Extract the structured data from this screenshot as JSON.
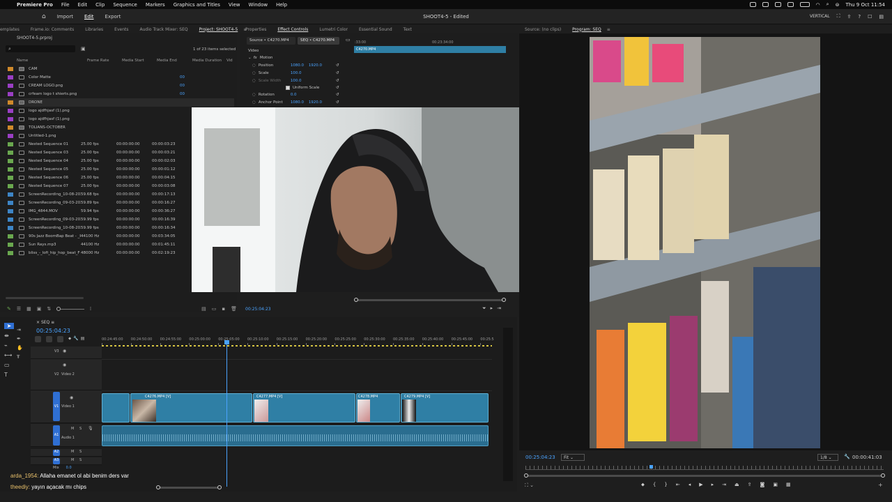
{
  "menubar": {
    "app_name": "Premiere Pro",
    "items": [
      "File",
      "Edit",
      "Clip",
      "Sequence",
      "Markers",
      "Graphics and Titles",
      "View",
      "Window",
      "Help"
    ],
    "datetime": "Thu 9 Oct  11:54"
  },
  "appheader": {
    "workspaces": [
      "Import",
      "Edit",
      "Export"
    ],
    "active_workspace": "Edit",
    "title": "SHOOT4-5 - Edited",
    "vertical_label": "VERTICAL"
  },
  "top_tabs": [
    "emplates",
    "Frame.io: Comments",
    "Libraries",
    "Events",
    "Audio Track Mixer: SEQ",
    "Project: SHOOT4-5"
  ],
  "active_top_tab": "Project: SHOOT4-5",
  "center_tabs": [
    "Properties",
    "Effect Controls",
    "Lumetri Color",
    "Essential Sound",
    "Text"
  ],
  "active_center_tab": "Effect Controls",
  "right_tabs": [
    "Source: (no clips)",
    "Program: SEQ"
  ],
  "active_right_tab": "Program: SEQ",
  "project": {
    "filename": "SHOOT4-5.prproj",
    "items_selected": "1 of 23 items selected",
    "columns": [
      "Name",
      "Frame Rate",
      "Media Start",
      "Media End",
      "Media Duration",
      "Vid"
    ],
    "rows": [
      {
        "name": "CAM",
        "fr": "",
        "ms": "",
        "me": "",
        "md": "",
        "color": "#d08a2b",
        "folder": true
      },
      {
        "name": "Color Matte",
        "fr": "",
        "ms": "",
        "me": "",
        "md": "00",
        "color": "#9a3fc4",
        "folder": false
      },
      {
        "name": "CREAM LOGO.png",
        "fr": "",
        "ms": "",
        "me": "",
        "md": "00",
        "color": "#9a3fc4",
        "folder": false
      },
      {
        "name": "crfeam logo t shierts.png",
        "fr": "",
        "ms": "",
        "me": "",
        "md": "00",
        "color": "#9a3fc4",
        "folder": false
      },
      {
        "name": "DRONE",
        "fr": "",
        "ms": "",
        "me": "",
        "md": "",
        "color": "#d08a2b",
        "folder": true
      },
      {
        "name": "logo ajdfhjasf (1).png",
        "fr": "",
        "ms": "",
        "me": "",
        "md": "",
        "color": "#9a3fc4",
        "folder": false
      },
      {
        "name": "logo ajdfhjasf (1).png",
        "fr": "",
        "ms": "",
        "me": "",
        "md": "",
        "color": "#9a3fc4",
        "folder": false
      },
      {
        "name": "TOLIANS-OCTOBER",
        "fr": "",
        "ms": "",
        "me": "",
        "md": "",
        "color": "#d08a2b",
        "folder": true
      },
      {
        "name": "Untitled-1.png",
        "fr": "",
        "ms": "",
        "me": "",
        "md": "",
        "color": "#9a3fc4",
        "folder": false
      },
      {
        "name": "Nested Sequence 01",
        "fr": "25.00 fps",
        "ms": "00:00:00:00",
        "me": "00:00:03:23",
        "md": "",
        "color": "#6aa84f",
        "folder": false
      },
      {
        "name": "Nested Sequence 03",
        "fr": "25.00 fps",
        "ms": "00:00:00:00",
        "me": "00:00:03:21",
        "md": "",
        "color": "#6aa84f",
        "folder": false
      },
      {
        "name": "Nested Sequence 04",
        "fr": "25.00 fps",
        "ms": "00:00:00:00",
        "me": "00:00:02:03",
        "md": "",
        "color": "#6aa84f",
        "folder": false
      },
      {
        "name": "Nested Sequence 05",
        "fr": "25.00 fps",
        "ms": "00:00:00:00",
        "me": "00:00:01:12",
        "md": "",
        "color": "#6aa84f",
        "folder": false
      },
      {
        "name": "Nested Sequence 06",
        "fr": "25.00 fps",
        "ms": "00:00:00:00",
        "me": "00:00:04:15",
        "md": "",
        "color": "#6aa84f",
        "folder": false
      },
      {
        "name": "Nested Sequence 07",
        "fr": "25.00 fps",
        "ms": "00:00:00:00",
        "me": "00:00:03:08",
        "md": "",
        "color": "#6aa84f",
        "folder": false
      },
      {
        "name": "ScreenRecording_10-08-202",
        "fr": "59.68 fps",
        "ms": "00:00:00:00",
        "me": "00:00:17:13",
        "md": "",
        "color": "#3d85c6",
        "folder": false
      },
      {
        "name": "ScreenRecording_09-03-202",
        "fr": "59.89 fps",
        "ms": "00:00:00:00",
        "me": "00:00:16:27",
        "md": "",
        "color": "#3d85c6",
        "folder": false
      },
      {
        "name": "IMG_4844.MOV",
        "fr": "59.94 fps",
        "ms": "00:00:00:00",
        "me": "00:00:36:27",
        "md": "",
        "color": "#3d85c6",
        "folder": false
      },
      {
        "name": "ScreenRecording_09-03-202",
        "fr": "59.99 fps",
        "ms": "00:00:00:00",
        "me": "00:00:16:39",
        "md": "",
        "color": "#3d85c6",
        "folder": false
      },
      {
        "name": "ScreenRecording_10-08-202",
        "fr": "59.99 fps",
        "ms": "00:00:00:00",
        "me": "00:00:16:34",
        "md": "",
        "color": "#3d85c6",
        "folder": false
      },
      {
        "name": "90s Jazz BoomBap Beat - _R",
        "fr": "44100 Hz",
        "ms": "00:00:00:00",
        "me": "00:03:34:05",
        "md": "",
        "color": "#6aa84f",
        "folder": false
      },
      {
        "name": "Sun Rays.mp3",
        "fr": "44100 Hz",
        "ms": "00:00:00:00",
        "me": "00:01:45:11",
        "md": "",
        "color": "#6aa84f",
        "folder": false
      },
      {
        "name": "bliss_-_lofi_hip_hop_beat_F",
        "fr": "48000 Hz",
        "ms": "00:00:00:00",
        "me": "00:02:19:23",
        "md": "",
        "color": "#6aa84f",
        "folder": false
      }
    ]
  },
  "effect_controls": {
    "source_tab": "Source • C4270.MP4",
    "seq_tab": "SEQ • C4270.MP4",
    "clip_label": "C4270.MP4",
    "ruler_left": ":33:00",
    "ruler_mid": "00:23:34:00",
    "section_video": "Video",
    "section_motion": "Motion",
    "properties": [
      {
        "name": "Position",
        "v1": "1080.0",
        "v2": "1920.0"
      },
      {
        "name": "Scale",
        "v1": "100.0",
        "v2": ""
      },
      {
        "name": "Scale Width",
        "v1": "100.0",
        "v2": ""
      },
      {
        "name": "Uniform Scale",
        "v1": "",
        "v2": ""
      },
      {
        "name": "Rotation",
        "v1": "0.0",
        "v2": ""
      },
      {
        "name": "Anchor Point",
        "v1": "1080.0",
        "v2": "1920.0"
      }
    ],
    "timecode": "00:25:04:23"
  },
  "timeline": {
    "seq_name": "SEQ",
    "timecode": "00:25:04:23",
    "ruler_labels": [
      "00:24:45:00",
      "00:24:50:00",
      "00:24:55:00",
      "00:25:00:00",
      "00:25:05:00",
      "00:25:10:00",
      "00:25:15:00",
      "00:25:20:00",
      "00:25:25:00",
      "00:25:30:00",
      "00:25:35:00",
      "00:25:40:00",
      "00:25:45:00",
      "00:25:5"
    ],
    "tracks": {
      "v3": "V3",
      "v2": "V2",
      "v2_name": "Video 2",
      "v1": "V1",
      "v1_name": "Video 1",
      "a1": "A1",
      "a1_name": "Audio 1",
      "a2": "A2",
      "a3": "A3",
      "mix": "Mix",
      "mix_val": "0.0"
    },
    "clips": [
      "C4276.MP4 [V]",
      "C4277.MP4 [V]",
      "C4278.MP4",
      "C4279.MP4 [V]"
    ]
  },
  "program": {
    "timecode": "00:25:04:23",
    "fit": "Fit",
    "quality": "1/8",
    "duration": "00:00:41:03"
  },
  "chat": [
    {
      "user": "arda_1954:",
      "msg": "Allaha emanet ol abi benim ders var"
    },
    {
      "user": "theediy:",
      "msg": "yayın açacak mı chips"
    }
  ],
  "colors": {
    "accent": "#4aa3ff",
    "clip": "#2f7fa5",
    "playhead": "#4aa3ff"
  }
}
